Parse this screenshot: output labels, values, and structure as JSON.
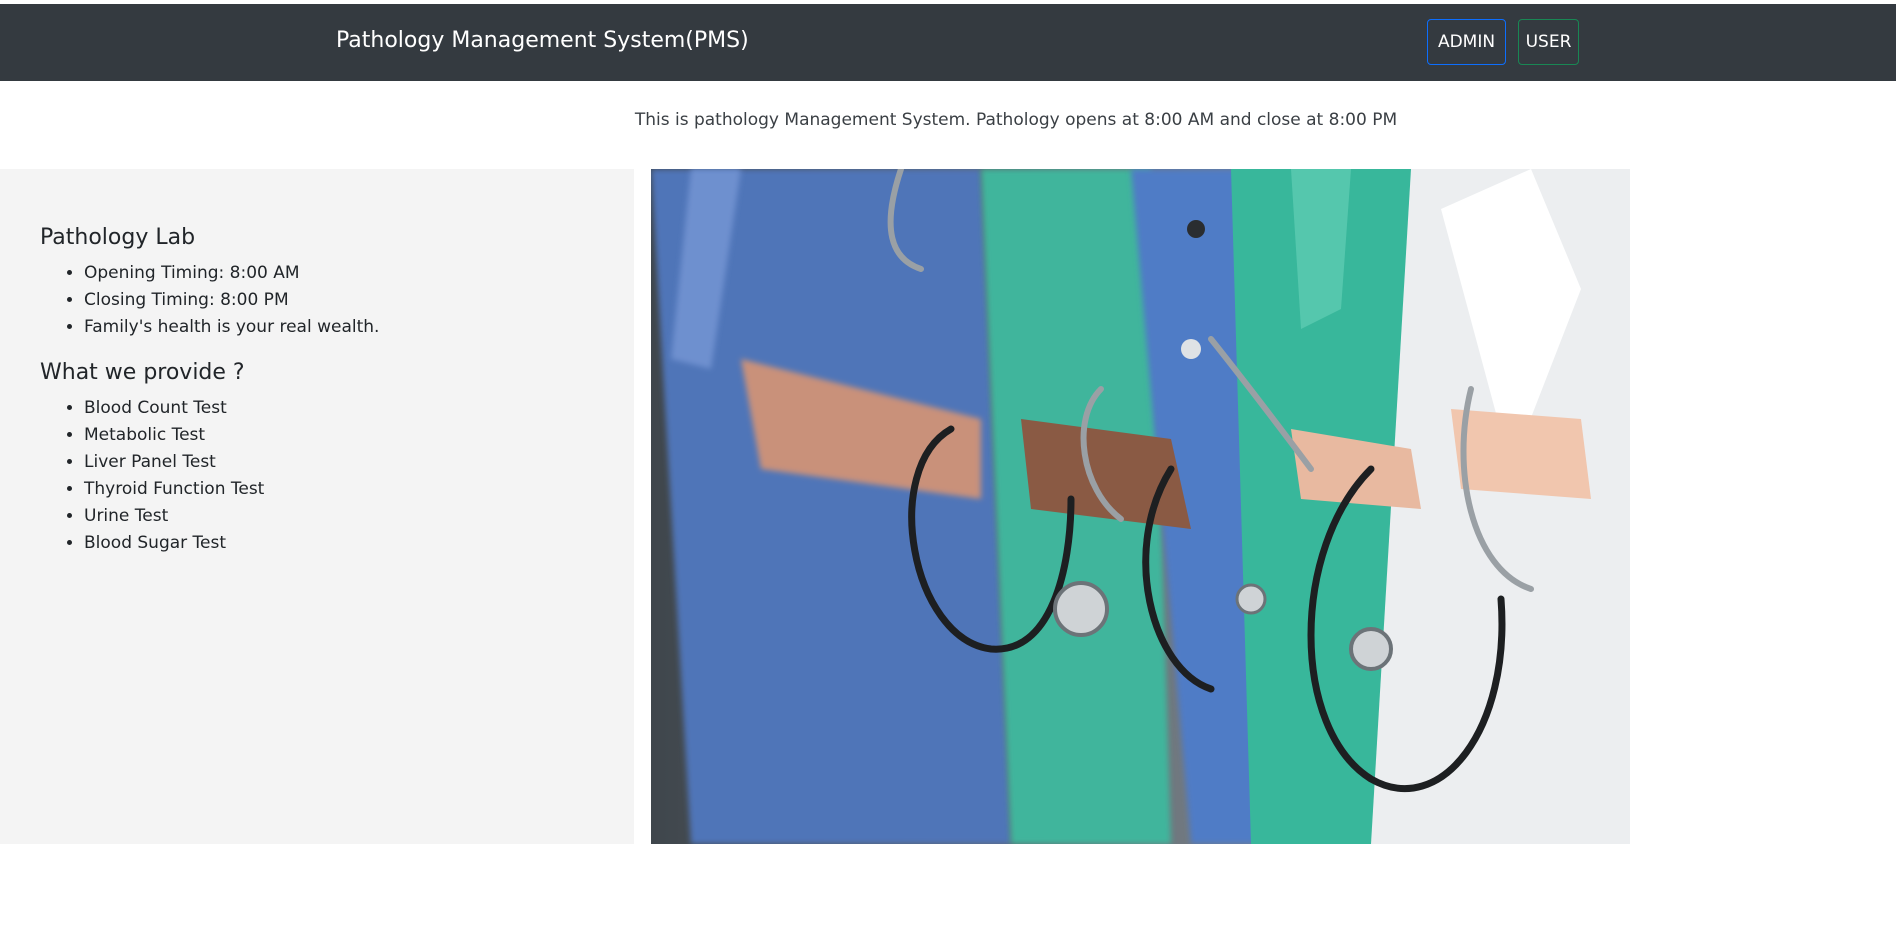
{
  "navbar": {
    "brand": "Pathology Management System(PMS)",
    "admin_label": "ADMIN",
    "user_label": "USER"
  },
  "intro_text": "This is pathology Management System. Pathology opens at 8:00 AM and close at 8:00 PM",
  "lab": {
    "heading": "Pathology Lab",
    "items": [
      "Opening Timing: 8:00 AM",
      "Closing Timing: 8:00 PM",
      "Family's health is your real wealth."
    ]
  },
  "services": {
    "heading": "What we provide ?",
    "items": [
      "Blood Count Test",
      "Metabolic Test",
      "Liver Panel Test",
      "Thyroid Function Test",
      "Urine Test",
      "Blood Sugar Test"
    ]
  },
  "hero_image": {
    "subject": "doctors-with-stethoscopes"
  },
  "colors": {
    "navbar_bg": "#343a40",
    "admin_border": "#0d6efd",
    "user_border": "#198754",
    "panel_bg": "#f4f4f4"
  }
}
